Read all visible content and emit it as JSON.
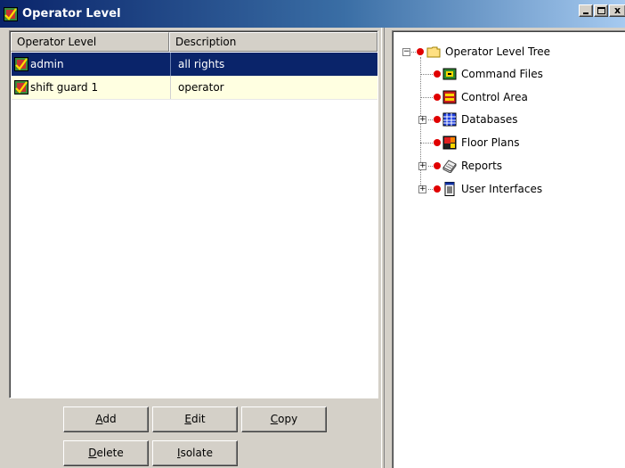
{
  "window": {
    "title": "Operator Level"
  },
  "colors": {
    "titlebar_start": "#0a246a",
    "titlebar_end": "#a6caf0",
    "selection": "#0a246a",
    "row_highlight": "#ffffe1",
    "tree_dot": "#e00000"
  },
  "list": {
    "headers": [
      "Operator Level",
      "Description"
    ],
    "rows": [
      {
        "name": "admin",
        "description": "all rights",
        "icon": "operator-level-icon",
        "selected": true
      },
      {
        "name": "shift guard 1",
        "description": "operator",
        "icon": "operator-level-icon",
        "selected": false
      }
    ]
  },
  "buttons": {
    "add": {
      "accel": "A",
      "rest": "dd"
    },
    "edit": {
      "accel": "E",
      "rest": "dit"
    },
    "copy": {
      "accel": "C",
      "rest": "opy"
    },
    "delete": {
      "accel": "D",
      "rest": "elete"
    },
    "isolate": {
      "accel": "I",
      "rest": "solate"
    }
  },
  "tree": {
    "root": {
      "label": "Operator Level Tree",
      "icon": "folder-icon",
      "expander": "minus"
    },
    "children": [
      {
        "label": "Command Files",
        "icon": "command-files-icon",
        "expander": null
      },
      {
        "label": "Control Area",
        "icon": "control-area-icon",
        "expander": null
      },
      {
        "label": "Databases",
        "icon": "databases-icon",
        "expander": "plus"
      },
      {
        "label": "Floor Plans",
        "icon": "floor-plans-icon",
        "expander": null
      },
      {
        "label": "Reports",
        "icon": "reports-icon",
        "expander": "plus"
      },
      {
        "label": "User Interfaces",
        "icon": "user-interfaces-icon",
        "expander": "plus"
      }
    ]
  }
}
